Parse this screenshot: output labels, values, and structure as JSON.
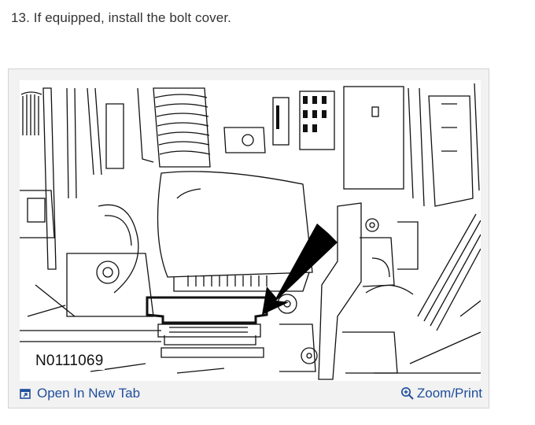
{
  "instruction": {
    "step_text": "13. If equipped, install the bolt cover."
  },
  "figure": {
    "figure_id": "N0111069",
    "open_label": "Open In New Tab",
    "zoom_label": "Zoom/Print"
  },
  "colors": {
    "link": "#1f4e9c",
    "card_bg": "#f2f2f2",
    "border": "#d4d4d4"
  },
  "icons": {
    "open": "open-in-new-tab-icon",
    "zoom": "zoom-magnifier-icon"
  }
}
